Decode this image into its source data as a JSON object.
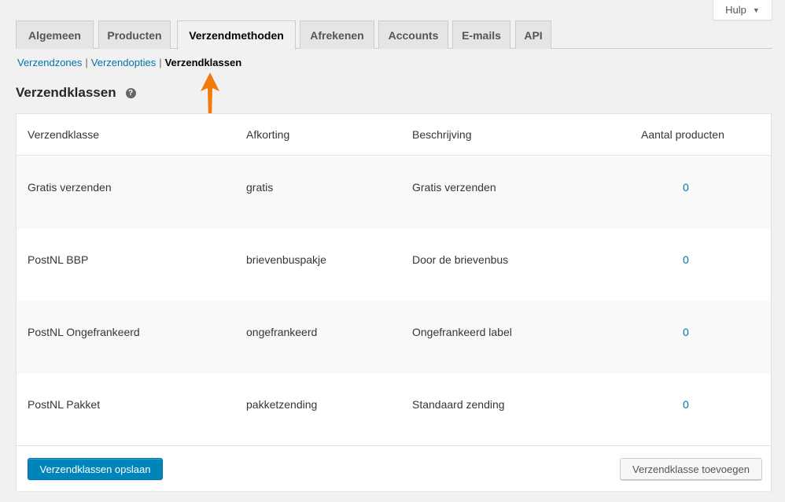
{
  "help": {
    "label": "Hulp"
  },
  "tabs": [
    {
      "label": "Algemeen"
    },
    {
      "label": "Producten"
    },
    {
      "label": "Verzendmethoden",
      "active": true
    },
    {
      "label": "Afrekenen"
    },
    {
      "label": "Accounts"
    },
    {
      "label": "E-mails"
    },
    {
      "label": "API"
    }
  ],
  "subnav": {
    "items": [
      "Verzendzones",
      "Verzendopties",
      "Verzendklassen"
    ],
    "separator": "|",
    "current": "Verzendklassen"
  },
  "section": {
    "title": "Verzendklassen",
    "help_icon": "?"
  },
  "annotation": {
    "color": "#f27b0a"
  },
  "table": {
    "headers": [
      "Verzendklasse",
      "Afkorting",
      "Beschrijving",
      "Aantal producten"
    ],
    "rows": [
      {
        "name": "Gratis verzenden",
        "slug": "gratis",
        "description": "Gratis verzenden",
        "count": "0"
      },
      {
        "name": "PostNL BBP",
        "slug": "brievenbuspakje",
        "description": "Door de brievenbus",
        "count": "0"
      },
      {
        "name": "PostNL Ongefrankeerd",
        "slug": "ongefrankeerd",
        "description": "Ongefrankeerd label",
        "count": "0"
      },
      {
        "name": "PostNL Pakket",
        "slug": "pakketzending",
        "description": "Standaard zending",
        "count": "0"
      }
    ]
  },
  "footer": {
    "save_label": "Verzendklassen opslaan",
    "add_label": "Verzendklasse toevoegen"
  },
  "colors": {
    "primary": "#0085ba",
    "link": "#0073aa"
  }
}
